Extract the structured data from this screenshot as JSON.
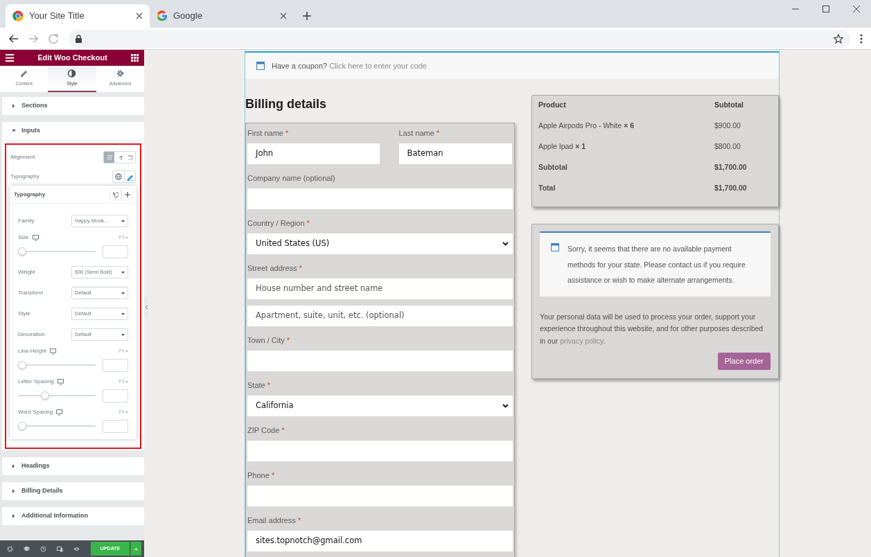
{
  "browser": {
    "tabs": [
      {
        "title": "Your Site Title",
        "selected": true,
        "kind": "chrome"
      },
      {
        "title": "Google",
        "selected": false,
        "kind": "google"
      }
    ]
  },
  "editor": {
    "title": "Edit Woo Checkout",
    "tabs": [
      {
        "label": "Content",
        "selected": false,
        "kind": "pencil"
      },
      {
        "label": "Style",
        "selected": true,
        "kind": "contrast"
      },
      {
        "label": "Advanced",
        "selected": false,
        "kind": "gear"
      }
    ],
    "sections": [
      {
        "label": "Sections",
        "expanded": false
      },
      {
        "label": "Inputs",
        "expanded": true
      },
      {
        "label": "Headings",
        "expanded": false
      },
      {
        "label": "Billing Details",
        "expanded": false
      },
      {
        "label": "Additional Information",
        "expanded": false
      }
    ],
    "alignment": {
      "label": "Alignment",
      "options": [
        {
          "selected": true
        },
        {
          "selected": false
        },
        {
          "selected": false
        }
      ]
    },
    "typography": {
      "label": "Typography",
      "popover_title": "Typography",
      "controls": [
        {
          "kind": "select",
          "label": "Family",
          "value": "Happy Monk..."
        },
        {
          "kind": "slider",
          "label": "Size",
          "unit": "PX",
          "level": 0
        },
        {
          "kind": "select",
          "label": "Weight",
          "value": "600 (Semi Bold)"
        },
        {
          "kind": "select",
          "label": "Transform",
          "value": "Default"
        },
        {
          "kind": "select",
          "label": "Style",
          "value": "Default"
        },
        {
          "kind": "select",
          "label": "Decoration",
          "value": "Default"
        },
        {
          "kind": "slider",
          "label": "Line-Height",
          "unit": "PX",
          "level": 0
        },
        {
          "kind": "slider",
          "label": "Letter Spacing",
          "unit": "PX",
          "level": 0.33
        },
        {
          "kind": "slider",
          "label": "Word Spacing",
          "unit": "PX",
          "level": 0
        }
      ]
    },
    "update_label": "UPDATE"
  },
  "page": {
    "coupon": {
      "text": "Have a coupon?",
      "link": "Click here to enter your code"
    },
    "billing_title": "Billing details",
    "required_mark": "*",
    "fields": [
      {
        "kind": "input",
        "label": "First name",
        "required": true,
        "value": "John",
        "half": true
      },
      {
        "kind": "input",
        "label": "Last name",
        "required": true,
        "value": "Bateman",
        "half": true
      },
      {
        "kind": "input",
        "label": "Company name (optional)",
        "required": false
      },
      {
        "kind": "select",
        "label": "Country / Region",
        "required": true,
        "value": "United States (US)"
      },
      {
        "kind": "input",
        "label": "Street address",
        "required": true,
        "placeholder": "House number and street name"
      },
      {
        "kind": "input",
        "placeholder": "Apartment, suite, unit, etc. (optional)"
      },
      {
        "kind": "input",
        "label": "Town / City",
        "required": true
      },
      {
        "kind": "select",
        "label": "State",
        "required": true,
        "value": "California"
      },
      {
        "kind": "input",
        "label": "ZIP Code",
        "required": true
      },
      {
        "kind": "input",
        "label": "Phone",
        "required": true
      },
      {
        "kind": "input",
        "label": "Email address",
        "required": true,
        "value": "sites.topnotch@gmail.com"
      }
    ],
    "order": {
      "columns": [
        "Product",
        "Subtotal"
      ],
      "rows": [
        {
          "kind": "item",
          "product": "Apple Airpods Pro - White",
          "qty": "× 6",
          "amount": "$900.00"
        },
        {
          "kind": "item",
          "product": "Apple Ipad",
          "qty": "× 1",
          "amount": "$800.00"
        },
        {
          "kind": "total",
          "product": "Subtotal",
          "amount": "$1,700.00"
        },
        {
          "kind": "total",
          "product": "Total",
          "amount": "$1,700.00"
        }
      ]
    },
    "payment_notice": "Sorry, it seems that there are no available payment methods for your state. Please contact us if you require assistance or wish to make alternate arrangements.",
    "privacy": {
      "text": "Your personal data will be used to process your order, support your experience throughout this website, and for other purposes described in our",
      "link": "privacy policy",
      "end": "."
    },
    "place_order": "Place order"
  }
}
